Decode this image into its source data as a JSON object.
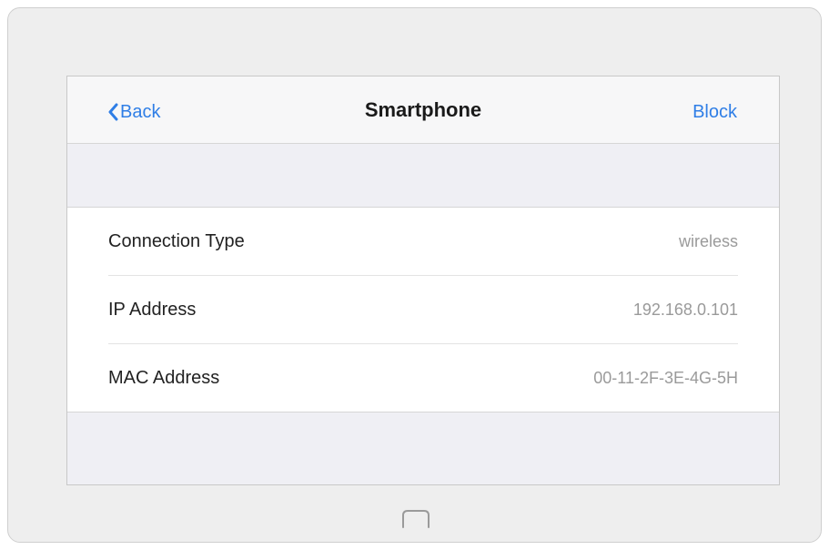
{
  "navbar": {
    "back_label": "Back",
    "title": "Smartphone",
    "block_label": "Block"
  },
  "details": [
    {
      "label": "Connection Type",
      "value": "wireless"
    },
    {
      "label": "IP Address",
      "value": "192.168.0.101"
    },
    {
      "label": "MAC Address",
      "value": "00-11-2F-3E-4G-5H"
    }
  ],
  "icons": {
    "back": "chevron-left-icon",
    "home": "home-button-icon"
  },
  "colors": {
    "accent": "#2f7ee6",
    "value_text": "#9a9a9a",
    "screen_bg": "#efeff4",
    "device_bg": "#eeeeee"
  }
}
